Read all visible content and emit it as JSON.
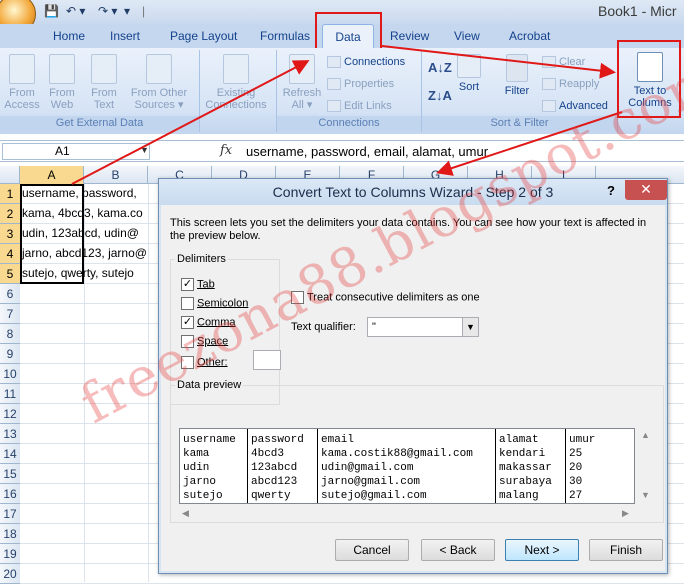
{
  "window": {
    "title": "Book1 - Micr"
  },
  "ribbon_tabs": [
    "Home",
    "Insert",
    "Page Layout",
    "Formulas",
    "Data",
    "Review",
    "View",
    "Acrobat"
  ],
  "groups": {
    "get_external": {
      "label": "Get External Data",
      "buttons": [
        "From\nAccess",
        "From\nWeb",
        "From\nText",
        "From Other\nSources ▾",
        "Existing\nConnections"
      ]
    },
    "connections": {
      "label": "Connections",
      "refresh": "Refresh\nAll ▾",
      "items": [
        "Connections",
        "Properties",
        "Edit Links"
      ]
    },
    "sort_filter": {
      "label": "Sort & Filter",
      "sort": "Sort",
      "filter": "Filter",
      "clear": "Clear",
      "reapply": "Reapply",
      "advanced": "Advanced"
    },
    "data_tools": {
      "text_to_columns": "Text to\nColumns"
    }
  },
  "formula_bar": {
    "name_box": "A1",
    "fx": "fx",
    "formula": "username, password, email, alamat, umur"
  },
  "columns": [
    "A",
    "B",
    "C",
    "D",
    "E",
    "F",
    "G",
    "H",
    "I"
  ],
  "rows": [
    "1",
    "2",
    "3",
    "4",
    "5",
    "6",
    "7",
    "8",
    "9",
    "10",
    "11",
    "12",
    "13",
    "14",
    "15",
    "16",
    "17",
    "18",
    "19",
    "20"
  ],
  "cells": [
    "username, password,",
    "kama, 4bcd3, kama.co",
    "udin, 123abcd, udin@",
    "jarno, abcd123, jarno@",
    "sutejo, qwerty, sutejo"
  ],
  "dialog": {
    "title": "Convert Text to Columns Wizard - Step 2 of 3",
    "help": "?",
    "close": "✕",
    "description": "This screen lets you set the delimiters your data contains.  You can see how your text is affected in the preview below.",
    "delimiters_legend": "Delimiters",
    "delimiters": [
      {
        "label": "Tab",
        "checked": true
      },
      {
        "label": "Semicolon",
        "checked": false
      },
      {
        "label": "Comma",
        "checked": true
      },
      {
        "label": "Space",
        "checked": false
      },
      {
        "label": "Other:",
        "checked": false
      }
    ],
    "consecutive": "Treat consecutive delimiters as one",
    "qualifier_label": "Text qualifier:",
    "qualifier_value": "\"",
    "preview_legend": "Data preview",
    "preview_columns": [
      [
        "username",
        "kama",
        "udin",
        "jarno",
        "sutejo"
      ],
      [
        "password",
        "4bcd3",
        "123abcd",
        "abcd123",
        "qwerty"
      ],
      [
        "email",
        "kama.costik88@gmail.com",
        "udin@gmail.com",
        "jarno@gmail.com",
        "sutejo@gmail.com"
      ],
      [
        "alamat",
        "kendari",
        "makassar",
        "surabaya",
        "malang"
      ],
      [
        "umur",
        "25",
        "20",
        "30",
        "27"
      ]
    ],
    "buttons": {
      "cancel": "Cancel",
      "back": "< Back",
      "next": "Next >",
      "finish": "Finish"
    }
  },
  "watermark": "freezona88.blogspot.com"
}
